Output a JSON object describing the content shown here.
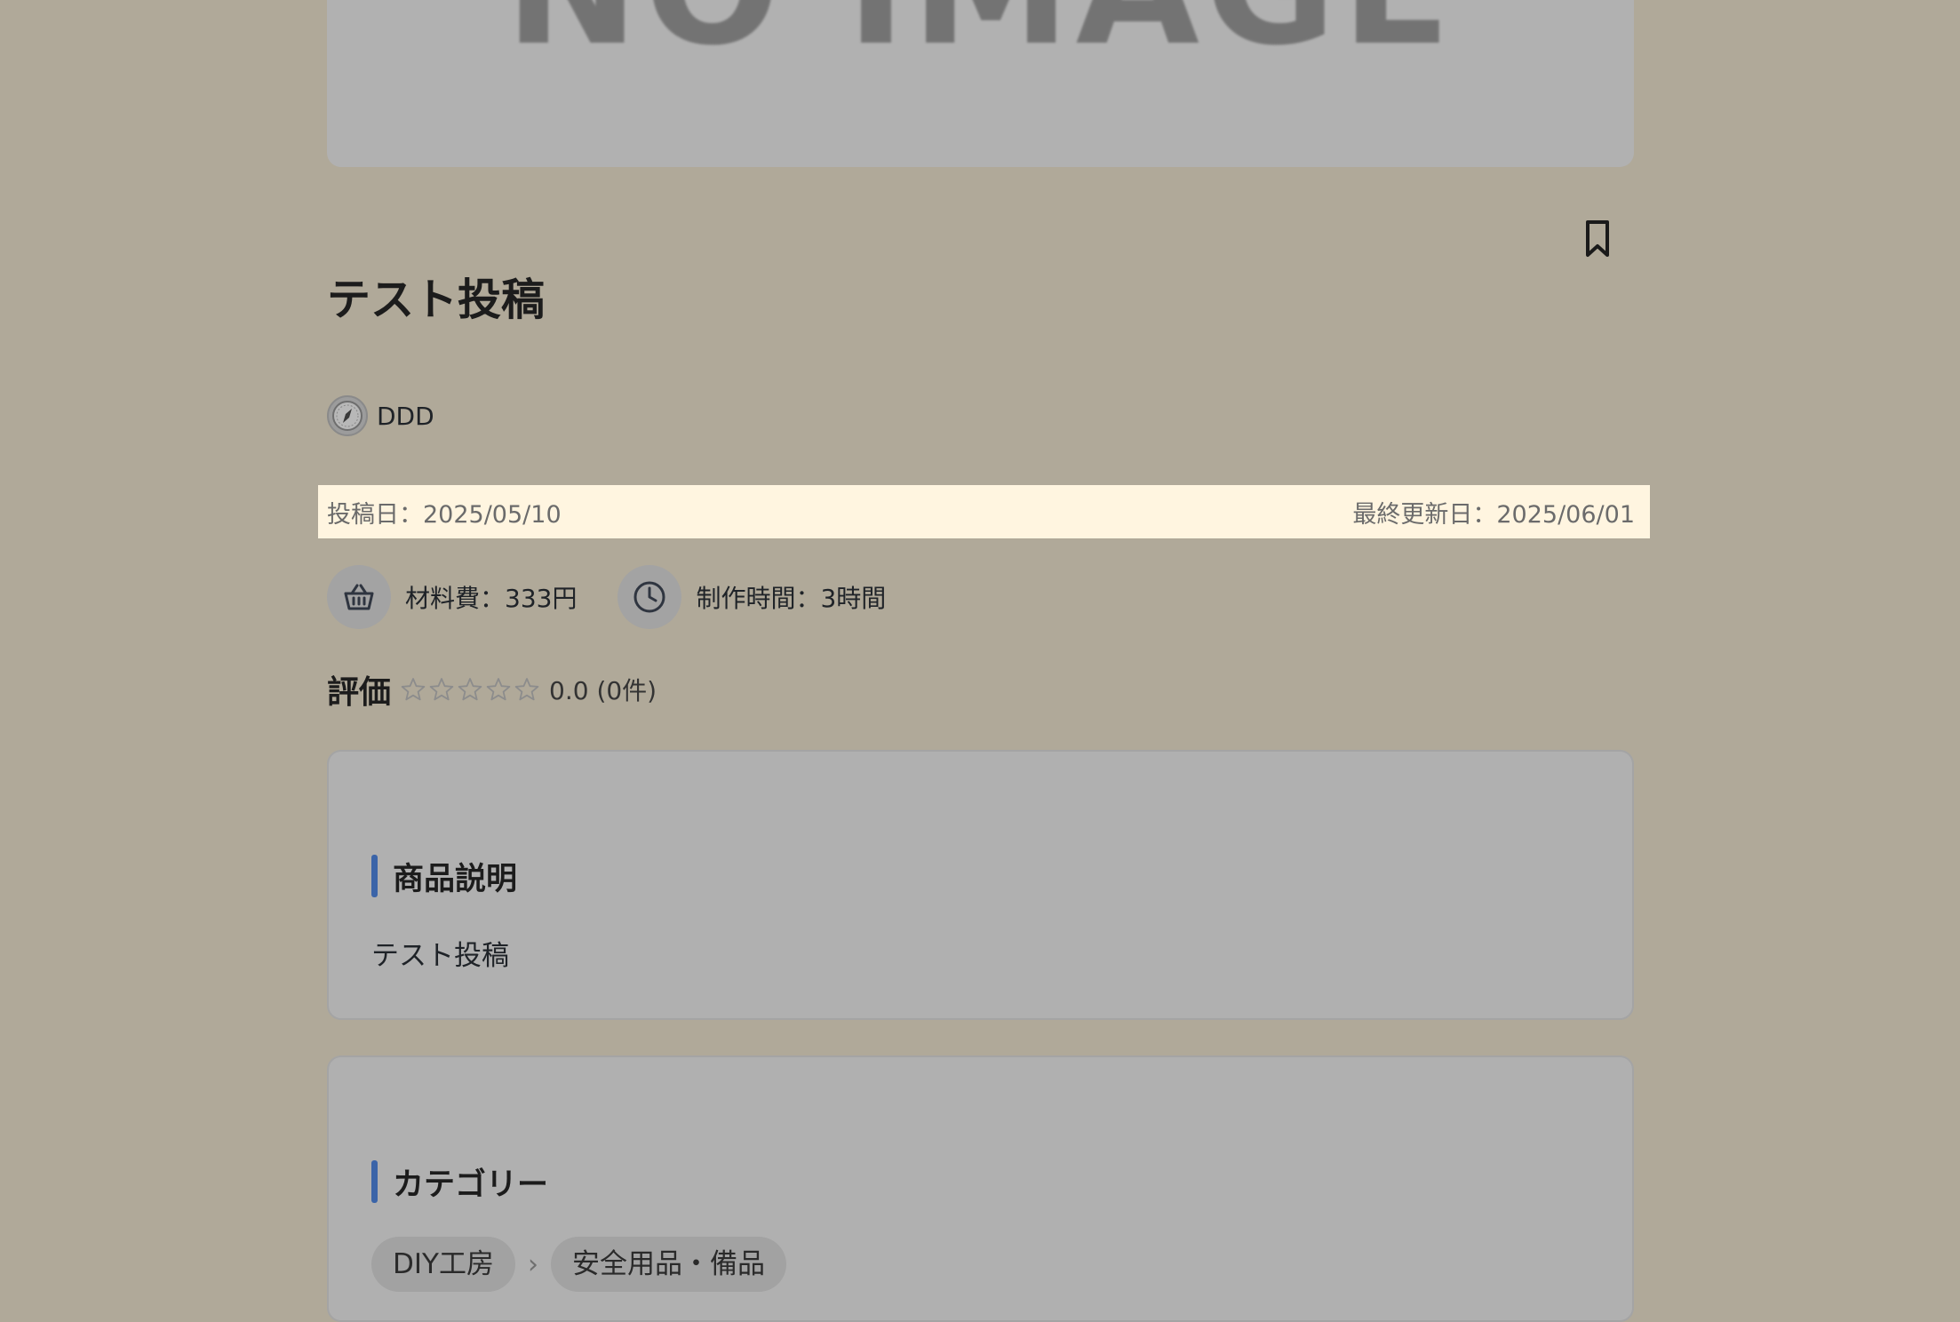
{
  "hero": {
    "placeholder_text": "NO IMAGE"
  },
  "post": {
    "title": "テスト投稿",
    "author": "DDD",
    "posted_date": "投稿日：2025/05/10",
    "updated_date": "最終更新日：2025/06/01",
    "material_cost": "材料費：333円",
    "production_time": "制作時間：3時間"
  },
  "rating": {
    "label": "評価",
    "stars_filled": 0,
    "stars_total": 5,
    "value_text": "0.0 (0件)"
  },
  "description": {
    "heading": "商品説明",
    "body": "テスト投稿"
  },
  "category": {
    "heading": "カテゴリー",
    "items": [
      "DIY工房",
      "安全用品・備品"
    ],
    "separator": "›"
  },
  "icons": {
    "bookmark": "bookmark-icon",
    "avatar": "avatar-compass-icon",
    "cost": "basket-icon",
    "time": "clock-icon",
    "star": "star-outline-icon"
  },
  "colors": {
    "background": "#b0a999",
    "accent": "#3b64a8",
    "date_band": "#fff5e0"
  }
}
